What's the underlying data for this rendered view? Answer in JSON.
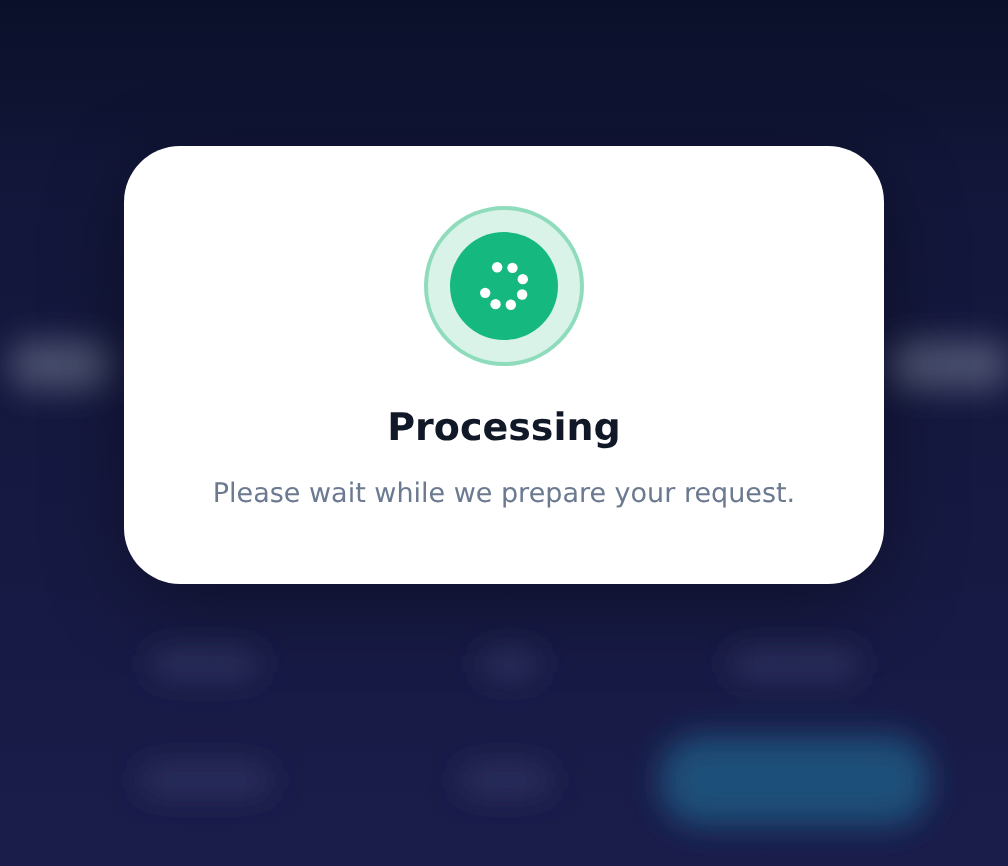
{
  "dialog": {
    "title": "Processing",
    "message": "Please wait while we prepare your request."
  }
}
